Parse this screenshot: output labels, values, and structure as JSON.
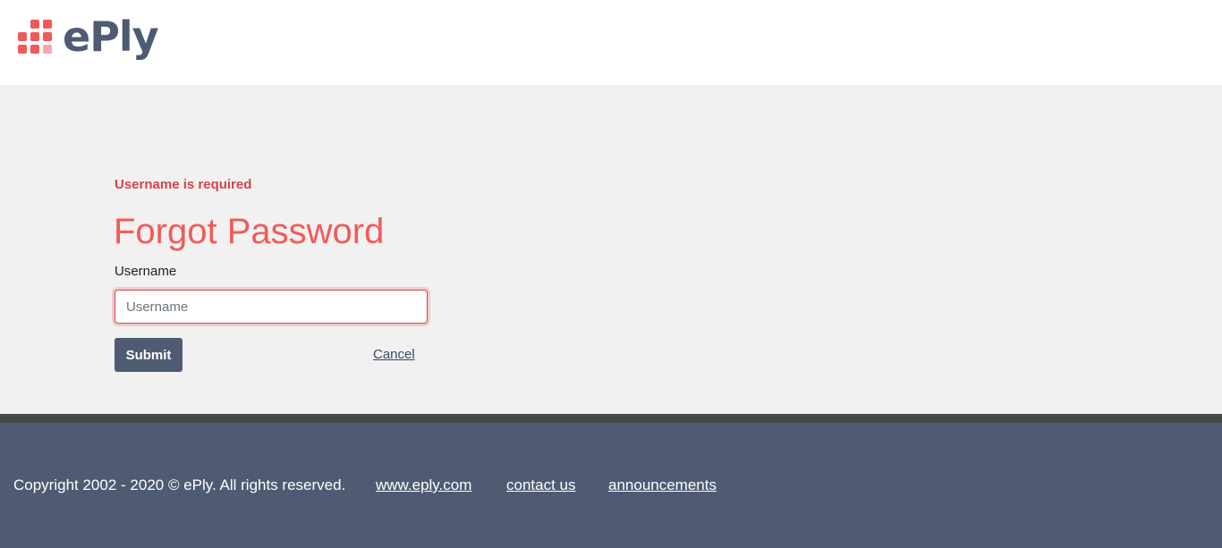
{
  "header": {
    "logo_text": "ePly"
  },
  "form": {
    "error_message": "Username is required",
    "title": "Forgot Password",
    "username_label": "Username",
    "username_placeholder": "Username",
    "username_value": "",
    "submit_label": "Submit",
    "cancel_label": "Cancel"
  },
  "footer": {
    "copyright": "Copyright 2002 - 2020 © ePly. All rights reserved.",
    "links": [
      "www.eply.com",
      "contact us",
      "announcements"
    ]
  },
  "colors": {
    "brand_red": "#ef5a5a",
    "brand_slate": "#4f5b72",
    "error_red": "#d9424b",
    "footer_bar": "#484848",
    "page_bg": "#f0f1f0"
  }
}
